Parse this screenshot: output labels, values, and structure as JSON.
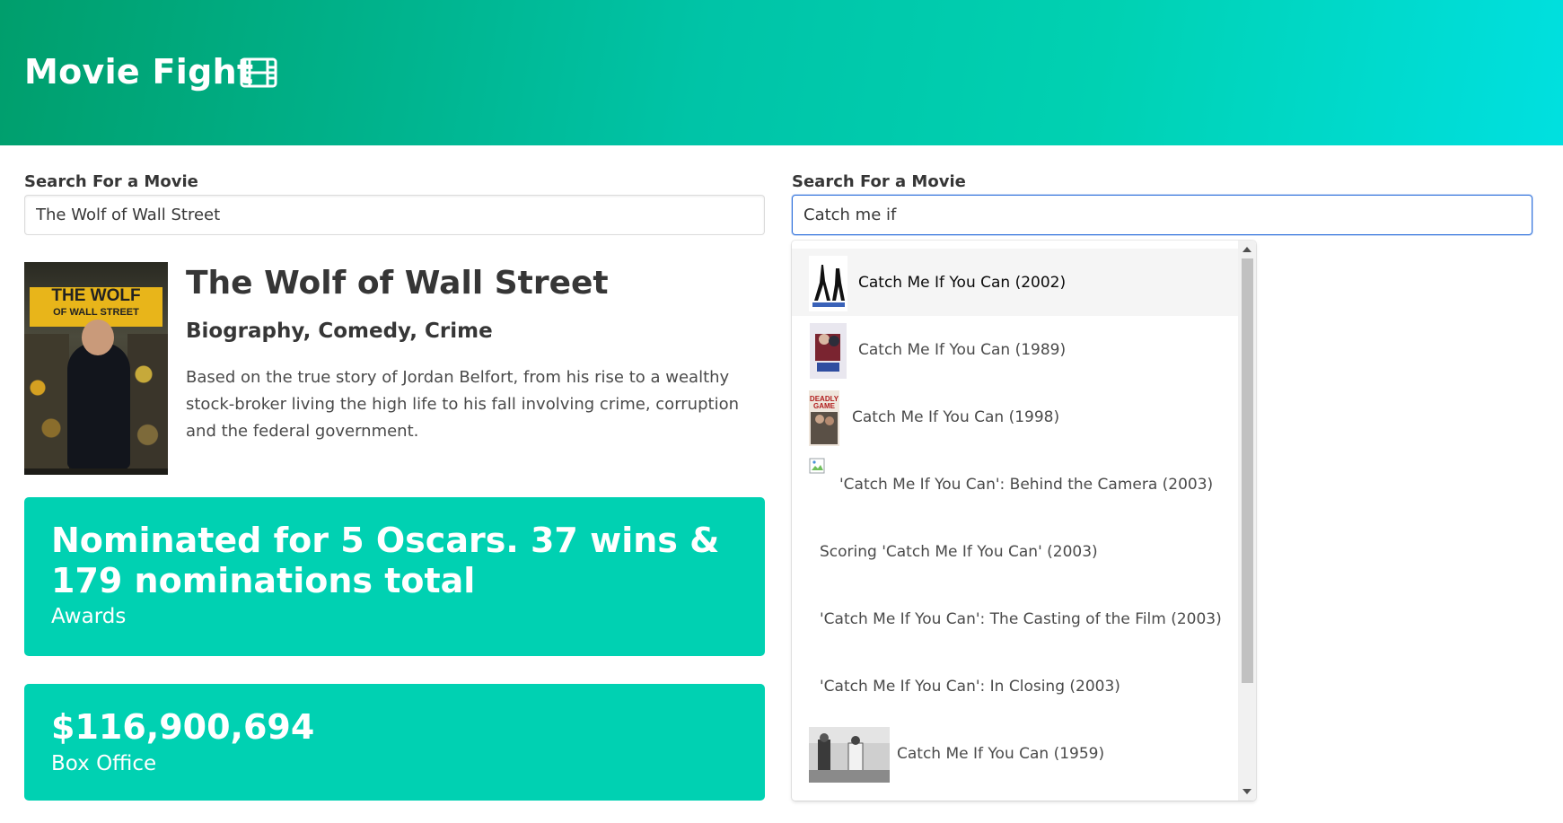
{
  "header": {
    "title": "Movie Fight",
    "icon": "film-icon"
  },
  "left": {
    "search_label": "Search For a Movie",
    "search_value": "The Wolf of Wall Street",
    "movie": {
      "poster_text_line1": "THE WOLF",
      "poster_text_line2": "OF WALL STREET",
      "title": "The Wolf of Wall Street",
      "genre": "Biography, Comedy, Crime",
      "plot": "Based on the true story of Jordan Belfort, from his rise to a wealthy stock-broker living the high life to his fall involving crime, corruption and the federal government.",
      "awards": {
        "value": "Nominated for 5 Oscars. 37 wins & 179 nominations total",
        "label": "Awards"
      },
      "box_office": {
        "value": "$116,900,694",
        "label": "Box Office"
      }
    }
  },
  "right": {
    "search_label": "Search For a Movie",
    "search_value": "Catch me if",
    "results": [
      {
        "label": "Catch Me If You Can (2002)",
        "thumb": "poster"
      },
      {
        "label": "Catch Me If You Can (1989)",
        "thumb": "poster"
      },
      {
        "label": "Catch Me If You Can (1998)",
        "thumb": "poster"
      },
      {
        "label": "'Catch Me If You Can': Behind the Camera (2003)",
        "thumb": "broken"
      },
      {
        "label": "Scoring 'Catch Me If You Can' (2003)",
        "thumb": "none"
      },
      {
        "label": "'Catch Me If You Can': The Casting of the Film (2003)",
        "thumb": "none"
      },
      {
        "label": "'Catch Me If You Can': In Closing (2003)",
        "thumb": "none"
      },
      {
        "label": "Catch Me If You Can (1959)",
        "thumb": "still"
      }
    ]
  },
  "colors": {
    "accent": "#00d1b2",
    "hero_start": "#009e6c",
    "hero_end": "#00e0e0",
    "focus": "#3273dc"
  }
}
